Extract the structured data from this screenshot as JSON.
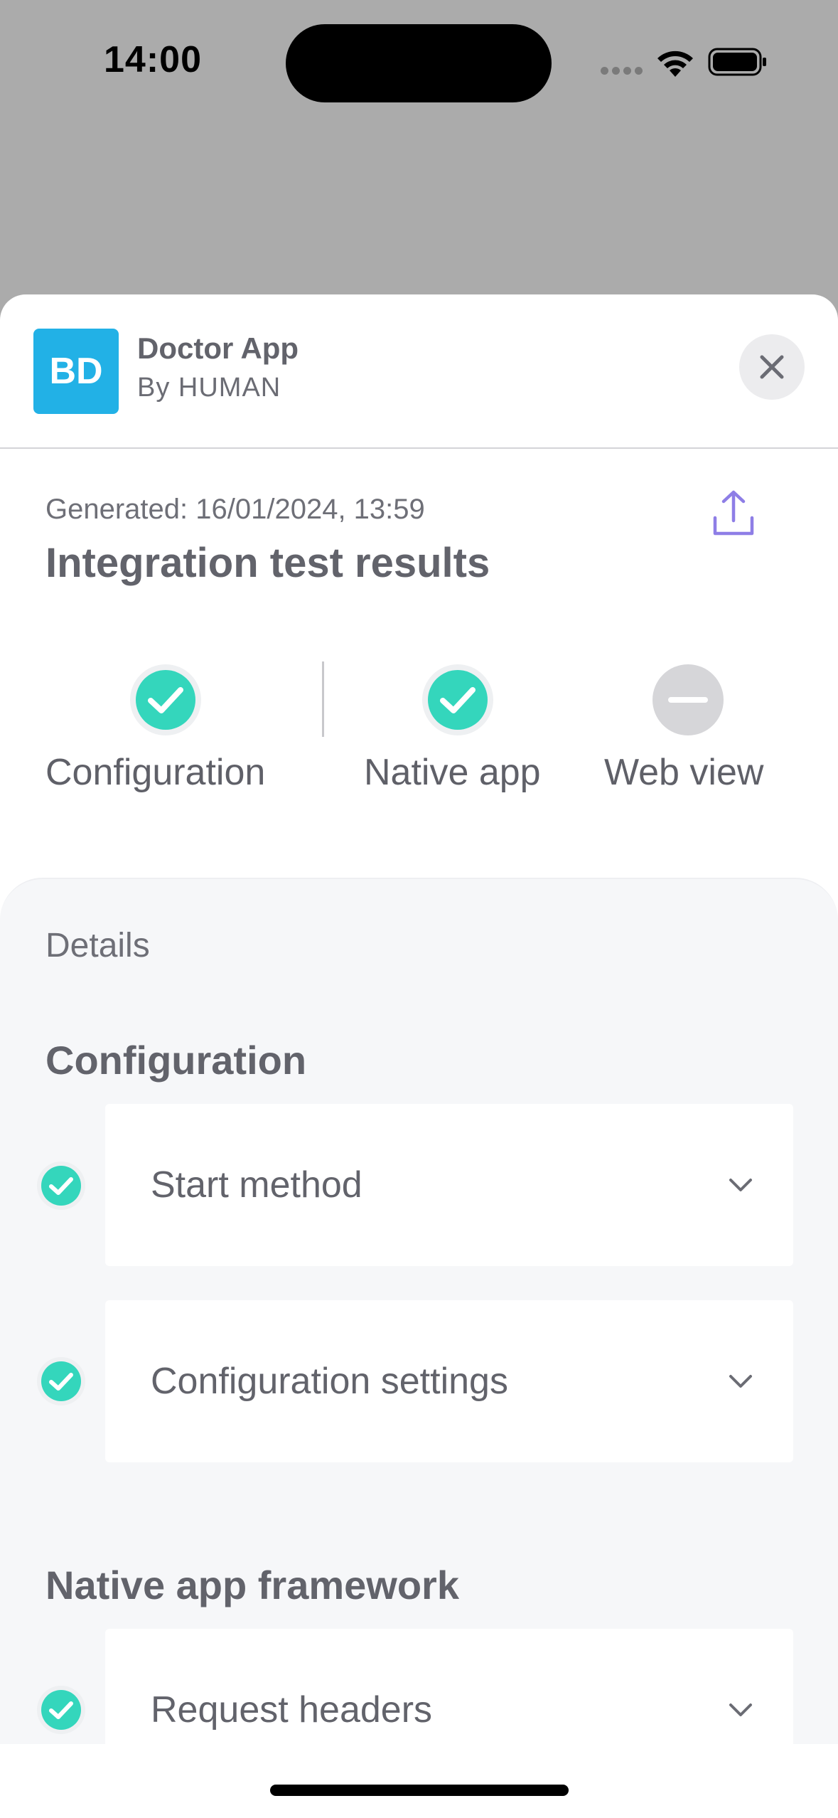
{
  "status_bar": {
    "time": "14:00"
  },
  "app": {
    "logo_text": "BD",
    "name": "Doctor App",
    "author": "By HUMAN"
  },
  "report": {
    "generated": "Generated: 16/01/2024, 13:59",
    "title": "Integration test results"
  },
  "summary": [
    {
      "label": "Configuration",
      "status": "passed"
    },
    {
      "label": "Native app",
      "status": "passed"
    },
    {
      "label": "Web view",
      "status": "not-run"
    }
  ],
  "details": {
    "label": "Details",
    "sections": [
      {
        "heading": "Configuration",
        "items": [
          {
            "label": "Start method",
            "status": "passed"
          },
          {
            "label": "Configuration settings",
            "status": "passed"
          }
        ]
      },
      {
        "heading": "Native app framework",
        "items": [
          {
            "label": "Request headers",
            "status": "passed"
          }
        ]
      }
    ]
  },
  "colors": {
    "accent": "#34d6bc",
    "logo": "#22b1e6",
    "share": "#8e7ee6",
    "neutral": "#d6d6d9"
  }
}
